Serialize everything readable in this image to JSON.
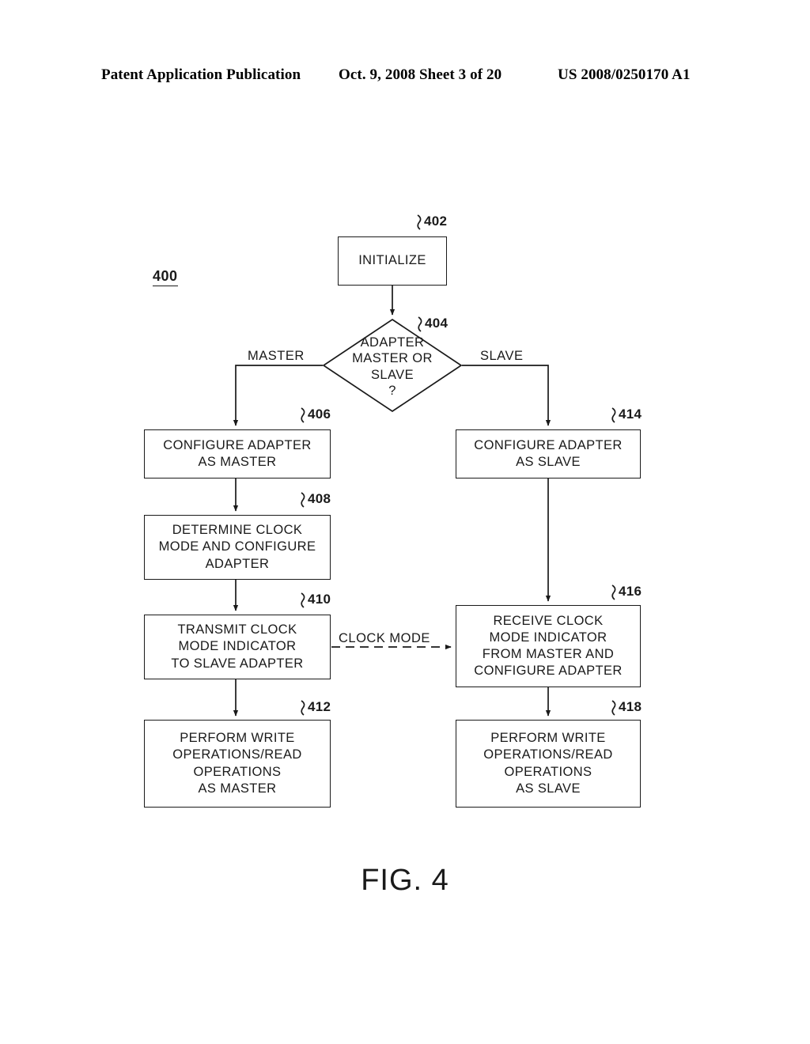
{
  "header": {
    "publication": "Patent Application Publication",
    "date": "Oct. 9, 2008",
    "sheet": "Sheet 3 of 20",
    "patent_number": "US 2008/0250170 A1"
  },
  "figure": {
    "caption": "FIG. 4",
    "diagram_ref": "400",
    "nodes": [
      {
        "ref": "402",
        "text": "INITIALIZE",
        "type": "process"
      },
      {
        "ref": "404",
        "text": "ADAPTER\nMASTER OR\nSLAVE\n?",
        "type": "decision"
      },
      {
        "ref": "406",
        "text": "CONFIGURE ADAPTER\nAS MASTER",
        "type": "process"
      },
      {
        "ref": "408",
        "text": "DETERMINE CLOCK\nMODE AND CONFIGURE\nADAPTER",
        "type": "process"
      },
      {
        "ref": "410",
        "text": "TRANSMIT CLOCK\nMODE INDICATOR\nTO SLAVE ADAPTER",
        "type": "process"
      },
      {
        "ref": "412",
        "text": "PERFORM WRITE\nOPERATIONS/READ\nOPERATIONS\nAS MASTER",
        "type": "process"
      },
      {
        "ref": "414",
        "text": "CONFIGURE ADAPTER\nAS SLAVE",
        "type": "process"
      },
      {
        "ref": "416",
        "text": "RECEIVE CLOCK\nMODE INDICATOR\nFROM MASTER AND\nCONFIGURE ADAPTER",
        "type": "process"
      },
      {
        "ref": "418",
        "text": "PERFORM WRITE\nOPERATIONS/READ\nOPERATIONS\nAS SLAVE",
        "type": "process"
      }
    ],
    "edge_labels": {
      "master_branch": "MASTER",
      "slave_branch": "SLAVE",
      "clock_mode": "CLOCK MODE"
    },
    "colors": {
      "ink": "#1a1a1a",
      "paper": "#ffffff"
    }
  }
}
